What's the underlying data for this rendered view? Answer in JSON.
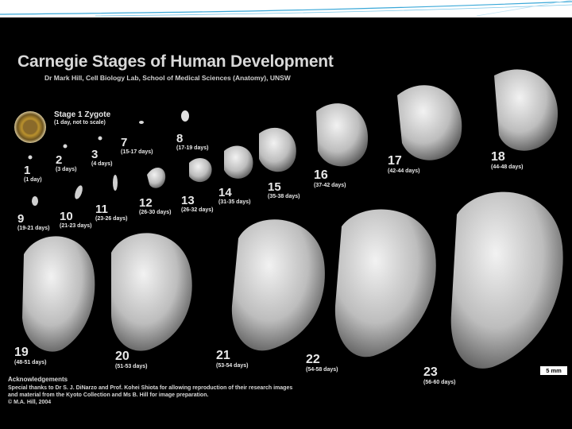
{
  "title": "Carnegie Stages of Human Development",
  "subtitle": "Dr Mark Hill, Cell Biology Lab, School of Medical Sciences (Anatomy), UNSW",
  "stage1": {
    "label": "Stage 1 Zygote",
    "days": "(1 day, not to scale)"
  },
  "stages": [
    {
      "num": "1",
      "days": "(1 day)"
    },
    {
      "num": "2",
      "days": "(3 days)"
    },
    {
      "num": "3",
      "days": "(4 days)"
    },
    {
      "num": "7",
      "days": "(15-17 days)"
    },
    {
      "num": "8",
      "days": "(17-19 days)"
    },
    {
      "num": "9",
      "days": "(19-21 days)"
    },
    {
      "num": "10",
      "days": "(21-23 days)"
    },
    {
      "num": "11",
      "days": "(23-26 days)"
    },
    {
      "num": "12",
      "days": "(26-30 days)"
    },
    {
      "num": "13",
      "days": "(26-32 days)"
    },
    {
      "num": "14",
      "days": "(31-35 days)"
    },
    {
      "num": "15",
      "days": "(35-38 days)"
    },
    {
      "num": "16",
      "days": "(37-42 days)"
    },
    {
      "num": "17",
      "days": "(42-44 days)"
    },
    {
      "num": "18",
      "days": "(44-48 days)"
    },
    {
      "num": "19",
      "days": "(48-51 days)"
    },
    {
      "num": "20",
      "days": "(51-53 days)"
    },
    {
      "num": "21",
      "days": "(53-54 days)"
    },
    {
      "num": "22",
      "days": "(54-58 days)"
    },
    {
      "num": "23",
      "days": "(56-60 days)"
    }
  ],
  "acknowledgements": {
    "title": "Acknowledgements",
    "text": "Special thanks to Dr S. J. DiNarzo and Prof. Kohei Shiota for allowing reproduction of their research images and material from the Kyoto Collection and Ms B. Hill for image preparation.",
    "copyright": "© M.A. Hill, 2004"
  },
  "scale_bar": "5 mm",
  "colors": {
    "background": "#000000",
    "embryo": "#d9d9d9",
    "text": "#e8e8e8",
    "accent": "#3aa8d8"
  }
}
